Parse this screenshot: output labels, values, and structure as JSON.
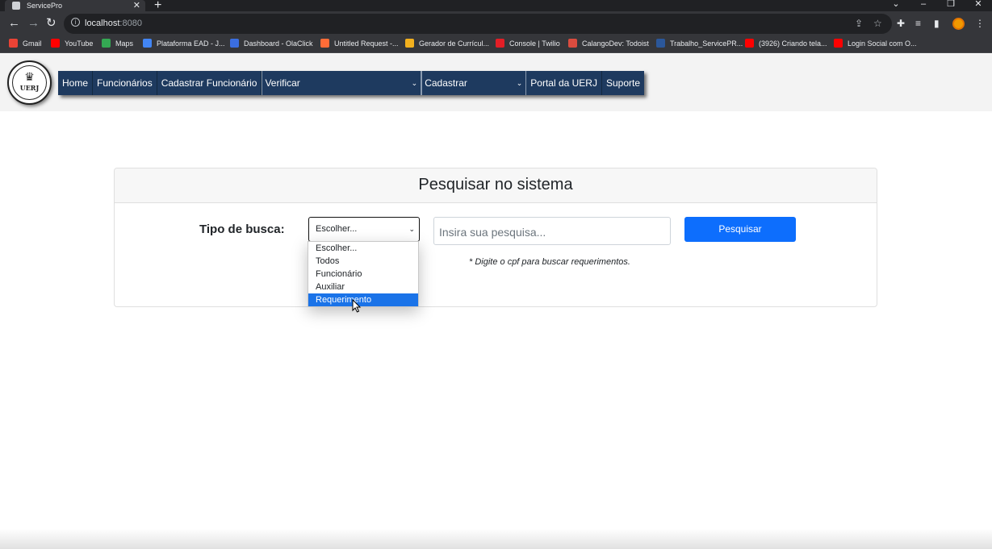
{
  "browser": {
    "tab_title": "ServicePro",
    "tab_close": "✕",
    "new_tab": "+",
    "url_host": "localhost",
    "url_port": ":8080",
    "window_controls": [
      "⌄",
      "–",
      "❐",
      "✕"
    ],
    "bookmarks": [
      {
        "label": "Gmail",
        "color": "#ea4335"
      },
      {
        "label": "YouTube",
        "color": "#ff0000"
      },
      {
        "label": "Maps",
        "color": "#34a853"
      },
      {
        "label": "Plataforma EAD - J...",
        "color": "#4285f4"
      },
      {
        "label": "Dashboard - OlaClick",
        "color": "#3b6ee0"
      },
      {
        "label": "Untitled Request -...",
        "color": "#ff6c37"
      },
      {
        "label": "Gerador de Currícul...",
        "color": "#f2b01e"
      },
      {
        "label": "Console | Twilio",
        "color": "#e31e26"
      },
      {
        "label": "CalangoDev: Todoist",
        "color": "#db4c3f"
      },
      {
        "label": "Trabalho_ServicePR...",
        "color": "#2b579a"
      },
      {
        "label": "(3926) Criando tela...",
        "color": "#ff0000"
      },
      {
        "label": "Login Social com O...",
        "color": "#ff0000"
      }
    ]
  },
  "header": {
    "logo_text": "UERJ",
    "nav": {
      "home": "Home",
      "funcionarios": "Funcionários",
      "cadastrar_funcionario": "Cadastrar Funcionário",
      "verificar": "Verificar",
      "cadastrar": "Cadastrar",
      "portal": "Portal da UERJ",
      "suporte": "Suporte"
    }
  },
  "search_card": {
    "title": "Pesquisar no sistema",
    "type_label": "Tipo de busca:",
    "type_selected": "Escolher...",
    "type_options": [
      "Escolher...",
      "Todos",
      "Funcionário",
      "Auxiliar",
      "Requerimento"
    ],
    "highlighted_option": "Requerimento",
    "search_placeholder": "Insira sua pesquisa...",
    "search_button": "Pesquisar",
    "hint": "* Digite o cpf para buscar requerimentos."
  },
  "colors": {
    "navbar": "#1e3a5f",
    "primary_button": "#0d6efd",
    "option_highlight": "#1a73e8"
  }
}
